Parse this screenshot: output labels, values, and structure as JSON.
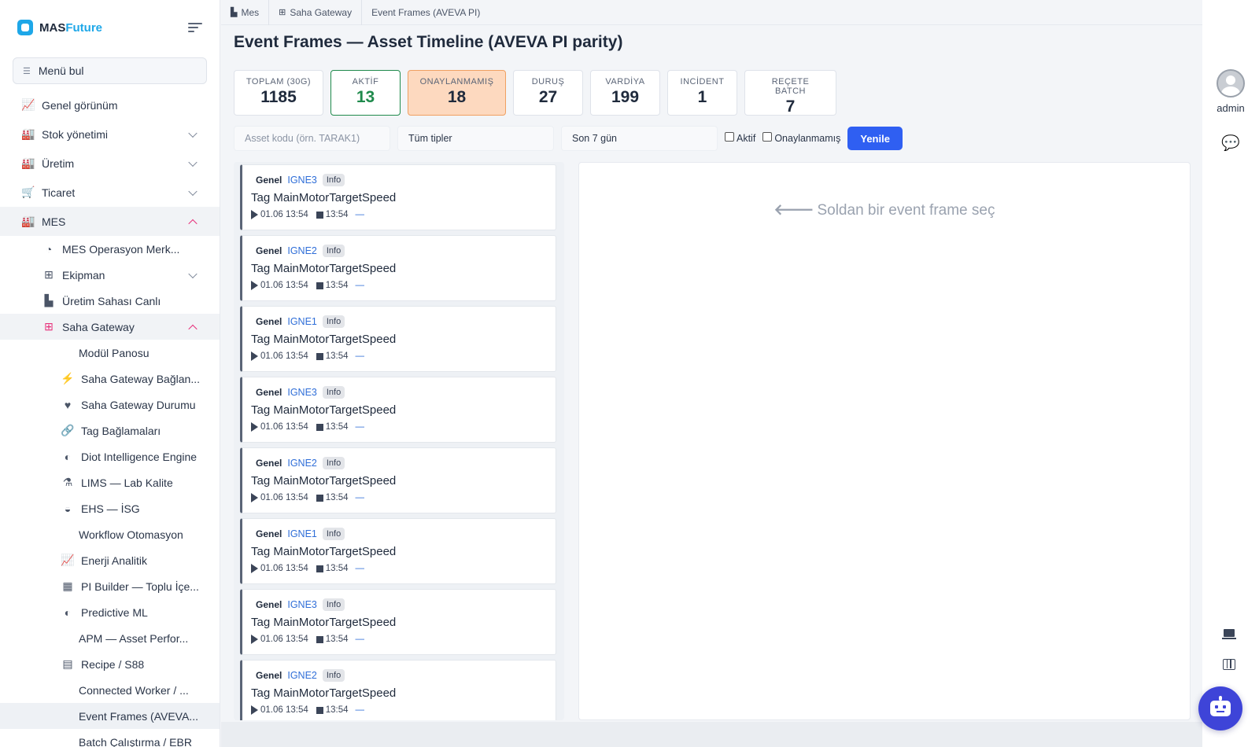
{
  "brand": {
    "part1": "MAS",
    "part2": "Future"
  },
  "sidebar": {
    "search_label": "Menü bul",
    "items": [
      {
        "label": "Genel görünüm",
        "icon": "chart-line-icon",
        "glyph": "📈",
        "level": 0
      },
      {
        "label": "Stok yönetimi",
        "icon": "warehouse-icon",
        "glyph": "🏭",
        "level": 0,
        "chevron": "down"
      },
      {
        "label": "Üretim",
        "icon": "industry-icon",
        "glyph": "🏭",
        "level": 0,
        "chevron": "down"
      },
      {
        "label": "Ticaret",
        "icon": "cart-icon",
        "glyph": "🛒",
        "level": 0,
        "chevron": "down"
      },
      {
        "label": "MES",
        "icon": "industry-icon",
        "glyph": "🏭",
        "level": 0,
        "chevron": "up",
        "expanded": true
      },
      {
        "label": "MES Operasyon Merk...",
        "icon": "gauge-icon",
        "glyph": "◔",
        "level": 1
      },
      {
        "label": "Ekipman",
        "icon": "sitemap-icon",
        "glyph": "⊞",
        "level": 1,
        "chevron": "down"
      },
      {
        "label": "Üretim Sahası Canlı",
        "icon": "industry-icon",
        "glyph": "▙",
        "level": 1
      },
      {
        "label": "Saha Gateway",
        "icon": "network-icon",
        "glyph": "⊞",
        "level": 1,
        "chevron": "up",
        "expanded": true
      },
      {
        "label": "Modül Panosu",
        "icon": "",
        "glyph": "",
        "level": 2
      },
      {
        "label": "Saha Gateway Bağlan...",
        "icon": "plug-icon",
        "glyph": "⚡",
        "level": 2
      },
      {
        "label": "Saha Gateway Durumu",
        "icon": "heart-pulse-icon",
        "glyph": "♥",
        "level": 2
      },
      {
        "label": "Tag Bağlamaları",
        "icon": "link-icon",
        "glyph": "🔗",
        "level": 2
      },
      {
        "label": "Diot Intelligence Engine",
        "icon": "brain-icon",
        "glyph": "◐",
        "level": 2
      },
      {
        "label": "LIMS — Lab Kalite",
        "icon": "flask-icon",
        "glyph": "⚗",
        "level": 2
      },
      {
        "label": "EHS — İSG",
        "icon": "hard-hat-icon",
        "glyph": "◒",
        "level": 2
      },
      {
        "label": "Workflow Otomasyon",
        "icon": "",
        "glyph": "",
        "level": 2
      },
      {
        "label": "Enerji Analitik",
        "icon": "chart-line-icon",
        "glyph": "📈",
        "level": 2
      },
      {
        "label": "PI Builder — Toplu İçe...",
        "icon": "table-icon",
        "glyph": "▦",
        "level": 2
      },
      {
        "label": "Predictive ML",
        "icon": "brain-icon",
        "glyph": "◐",
        "level": 2
      },
      {
        "label": "APM — Asset Perfor...",
        "icon": "",
        "glyph": "",
        "level": 2
      },
      {
        "label": "Recipe / S88",
        "icon": "book-icon",
        "glyph": "▤",
        "level": 2
      },
      {
        "label": "Connected Worker / ...",
        "icon": "",
        "glyph": "",
        "level": 2
      },
      {
        "label": "Event Frames (AVEVA...",
        "icon": "",
        "glyph": "",
        "level": 2,
        "current": true
      },
      {
        "label": "Batch Çalıştırma / EBR",
        "icon": "",
        "glyph": "",
        "level": 2
      }
    ]
  },
  "breadcrumb": [
    {
      "label": "Mes",
      "icon": "industry-icon",
      "glyph": "▙"
    },
    {
      "label": "Saha Gateway",
      "icon": "sitemap-icon",
      "glyph": "⊞"
    },
    {
      "label": "Event Frames (AVEVA PI)",
      "icon": "",
      "glyph": ""
    }
  ],
  "page": {
    "title": "Event Frames — Asset Timeline (AVEVA PI parity)"
  },
  "kpis": [
    {
      "label": "TOPLAM (30G)",
      "value": "1185",
      "style": ""
    },
    {
      "label": "AKTİF",
      "value": "13",
      "style": "green"
    },
    {
      "label": "ONAYLANMAMIŞ",
      "value": "18",
      "style": "orange"
    },
    {
      "label": "DURUŞ",
      "value": "27",
      "style": ""
    },
    {
      "label": "VARDİYA",
      "value": "199",
      "style": ""
    },
    {
      "label": "INCİDENT",
      "value": "1",
      "style": ""
    },
    {
      "label": "REÇETE BATCH",
      "value": "7",
      "style": ""
    }
  ],
  "filters": {
    "asset_placeholder": "Asset kodu (örn. TARAK1)",
    "asset_value": "",
    "type_value": "Tüm tipler",
    "range_value": "Son 7 gün",
    "active_label": "Aktif",
    "unack_label": "Onaylanmamış",
    "refresh_label": "Yenile"
  },
  "event_frames": [
    {
      "category": "Genel",
      "asset": "IGNE3",
      "severity": "Info",
      "title": "Tag MainMotorTargetSpeed",
      "start": "01.06 13:54",
      "end": "13:54",
      "duration": "—"
    },
    {
      "category": "Genel",
      "asset": "IGNE2",
      "severity": "Info",
      "title": "Tag MainMotorTargetSpeed",
      "start": "01.06 13:54",
      "end": "13:54",
      "duration": "—"
    },
    {
      "category": "Genel",
      "asset": "IGNE1",
      "severity": "Info",
      "title": "Tag MainMotorTargetSpeed",
      "start": "01.06 13:54",
      "end": "13:54",
      "duration": "—"
    },
    {
      "category": "Genel",
      "asset": "IGNE3",
      "severity": "Info",
      "title": "Tag MainMotorTargetSpeed",
      "start": "01.06 13:54",
      "end": "13:54",
      "duration": "—"
    },
    {
      "category": "Genel",
      "asset": "IGNE2",
      "severity": "Info",
      "title": "Tag MainMotorTargetSpeed",
      "start": "01.06 13:54",
      "end": "13:54",
      "duration": "—"
    },
    {
      "category": "Genel",
      "asset": "IGNE1",
      "severity": "Info",
      "title": "Tag MainMotorTargetSpeed",
      "start": "01.06 13:54",
      "end": "13:54",
      "duration": "—"
    },
    {
      "category": "Genel",
      "asset": "IGNE3",
      "severity": "Info",
      "title": "Tag MainMotorTargetSpeed",
      "start": "01.06 13:54",
      "end": "13:54",
      "duration": "—"
    },
    {
      "category": "Genel",
      "asset": "IGNE2",
      "severity": "Info",
      "title": "Tag MainMotorTargetSpeed",
      "start": "01.06 13:54",
      "end": "13:54",
      "duration": "—"
    }
  ],
  "detail": {
    "empty_message": "Soldan bir event frame seç"
  },
  "user": {
    "name": "admin"
  },
  "colors": {
    "accent": "#2f5ff2",
    "active_green": "#1f8a4c",
    "unack_orange": "#fdd9bf",
    "mes_pink": "#e7307a",
    "bot": "#3e44d8"
  }
}
